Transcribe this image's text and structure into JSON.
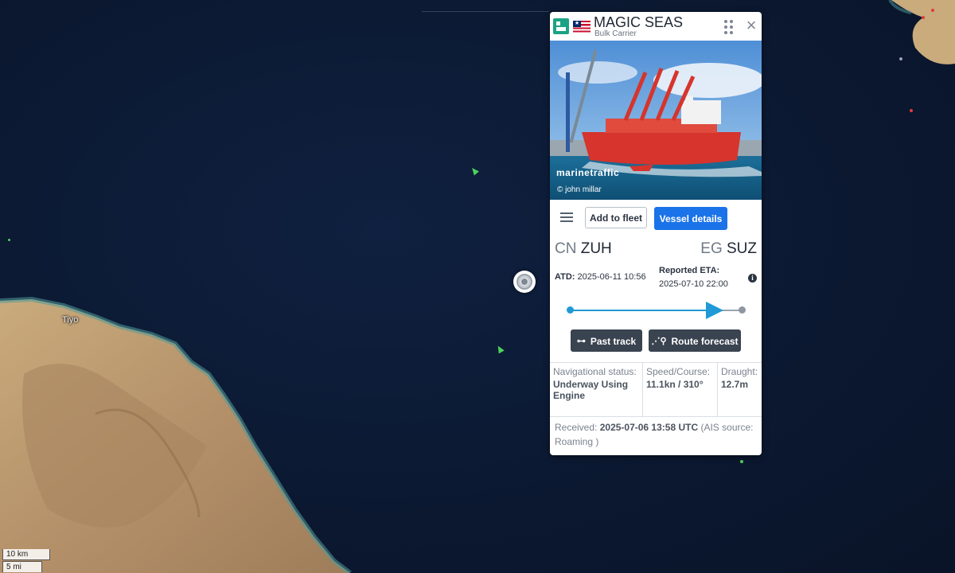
{
  "map": {
    "town_label": "Tiyo",
    "scale_km": "10 km",
    "scale_mi": "5 mi"
  },
  "panel": {
    "vessel_name": "MAGIC SEAS",
    "vessel_type": "Bulk Carrier",
    "type_icon": "cargo-type-icon",
    "flag": "liberia-flag-icon",
    "photo_watermark": "marinetraffic",
    "photo_credit": "© john millar",
    "buttons": {
      "add_to_fleet": "Add to fleet",
      "vessel_details": "Vessel details",
      "past_track": "Past track",
      "route_forecast": "Route forecast"
    },
    "departure": {
      "country": "CN",
      "port": "ZUH"
    },
    "destination": {
      "country": "EG",
      "port": "SUZ"
    },
    "atd_label": "ATD:",
    "atd_value": "2025-06-11 10:56",
    "eta_label": "Reported ETA:",
    "eta_value": "2025-07-10 22:00",
    "voyage_progress": 0.87,
    "nav_status_label": "Navigational status:",
    "nav_status_value": "Underway Using Engine",
    "speed_course_label": "Speed/Course:",
    "speed_course_value": "11.1kn / 310°",
    "draught_label": "Draught:",
    "draught_value": "12.7m",
    "received_label": "Received:",
    "received_value": "2025-07-06 13:58 UTC",
    "ais_source_label": "(AIS source:",
    "ais_source_value": "Roaming )",
    "colors": {
      "primary": "#1a73e8",
      "route": "#1f9ad6",
      "dark_button": "#3a4350",
      "type_icon": "#1ba385"
    }
  }
}
